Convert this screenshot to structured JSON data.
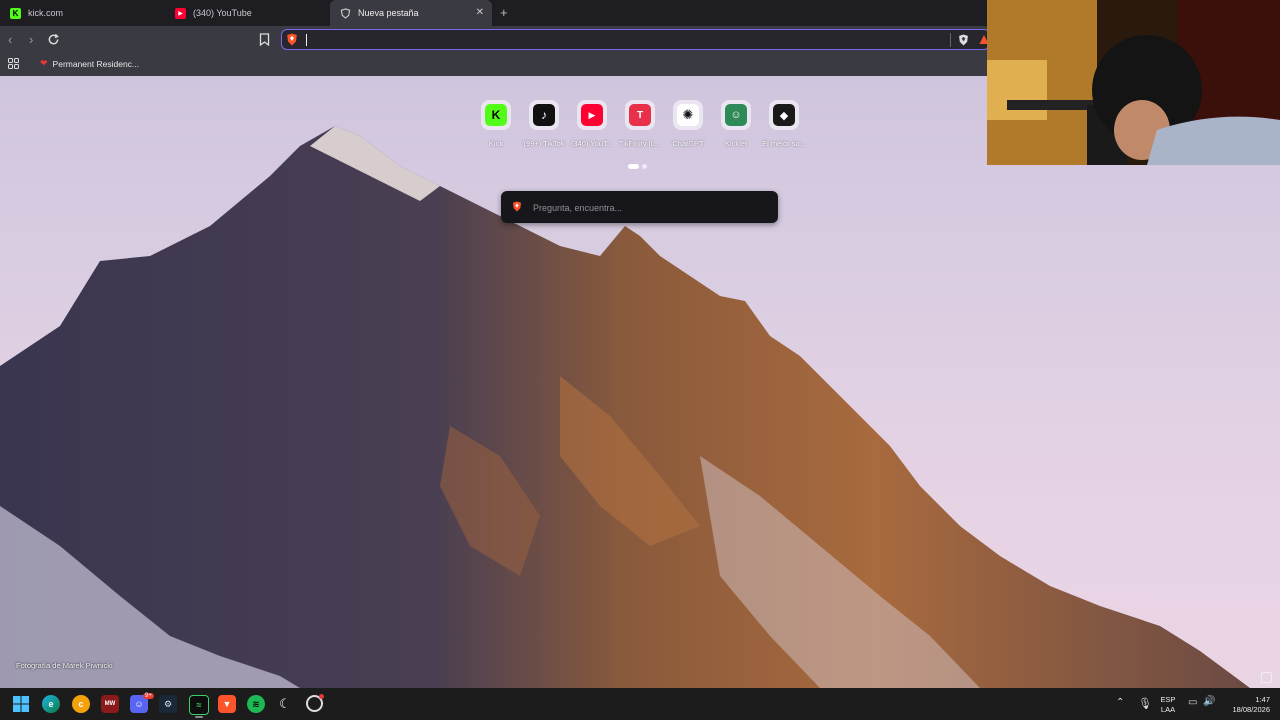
{
  "tabs": [
    {
      "title": "kick.com",
      "icon": "kick-icon",
      "color": "#53fc18"
    },
    {
      "title": "(340) YouTube",
      "icon": "youtube-icon",
      "color": "#ff0033"
    },
    {
      "title": "Nueva pestaña",
      "icon": "brave-shield-icon",
      "color": "#bbbbbb"
    }
  ],
  "toolbar": {
    "url_value": "",
    "accent": "#7b68ee"
  },
  "bookmarks": [
    {
      "label": "Permanent Residenc...",
      "icon": "bookmark-favicon"
    }
  ],
  "new_tab": {
    "top_sites": [
      {
        "label": "Kick",
        "icon": "kick-icon",
        "color": "#53fc18"
      },
      {
        "label": "(99+) TikTok",
        "icon": "tiktok-icon",
        "color": "#111111"
      },
      {
        "label": "(340) YouT...",
        "icon": "youtube-icon",
        "color": "#ff0033"
      },
      {
        "label": "TikFinity [L...",
        "icon": "tikfinity-icon",
        "color": "#e8304a"
      },
      {
        "label": "ChatGPT",
        "icon": "chatgpt-icon",
        "color": "#ffffff"
      },
      {
        "label": "Kicklet",
        "icon": "kicklet-icon",
        "color": "#2e8b57"
      },
      {
        "label": "El mejor so...",
        "icon": "shield-icon",
        "color": "#1a1a1a"
      }
    ],
    "search_placeholder": "Pregunta, encuentra...",
    "photo_credit": "Fotografía de Marek Piwnicki"
  },
  "taskbar": {
    "apps": [
      "windows-start-icon",
      "edge-icon",
      "crunchyroll-icon",
      "mobile-game-icon",
      "discord-icon",
      "steam-icon",
      "streaming-app-icon",
      "brave-icon",
      "spotify-icon",
      "controller-icon",
      "obs-icon"
    ],
    "lang": "ESP",
    "lang_sub": "LAA",
    "time": "1:47",
    "date": "18/08/2026",
    "notification_badge": "9+"
  }
}
